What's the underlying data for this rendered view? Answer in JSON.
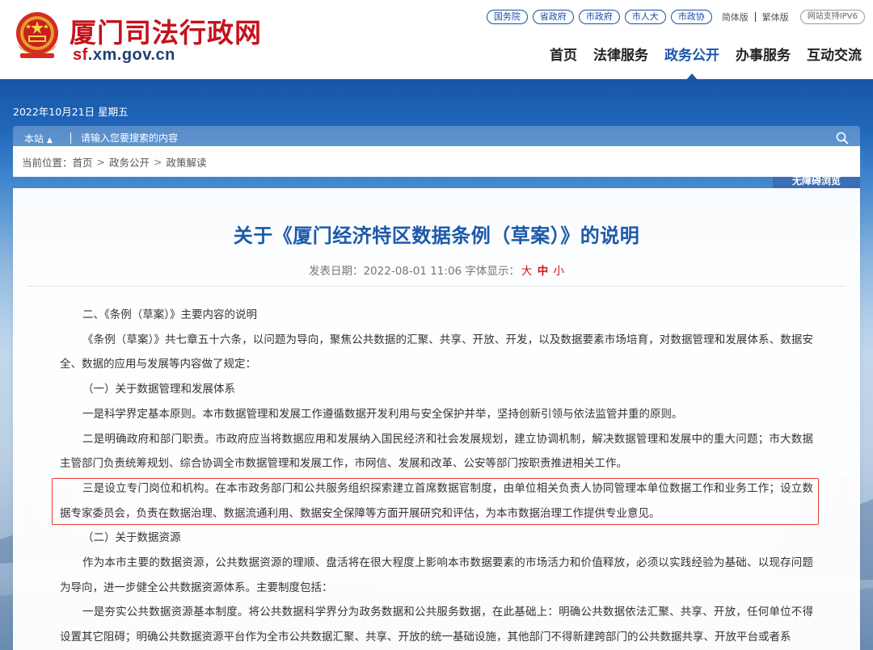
{
  "site": {
    "title": "厦门司法行政网",
    "domain_prefix": "sf",
    "domain_suffix": ".xm.gov.cn"
  },
  "top_links": {
    "pills": [
      "国务院",
      "省政府",
      "市政府",
      "市人大",
      "市政协"
    ],
    "simplified": "简体版",
    "traditional": "繁体版",
    "ipv6": "网站支持IPV6"
  },
  "nav": {
    "items": [
      "首页",
      "法律服务",
      "政务公开",
      "办事服务",
      "互动交流"
    ],
    "active": "政务公开"
  },
  "banner": {
    "date": "2022年10月21日 星期五"
  },
  "search": {
    "scope": "本站",
    "placeholder": "请输入您要搜索的内容",
    "access_label": "无障碍浏览"
  },
  "breadcrumb": {
    "prefix": "当前位置：",
    "items": [
      "首页",
      "政务公开",
      "政策解读"
    ],
    "separator": ">"
  },
  "article": {
    "title": "关于《厦门经济特区数据条例（草案）》的说明",
    "date_label": "发表日期：",
    "date": "2022-08-01 11:06",
    "font_label": "字体显示：",
    "font_big": "大",
    "font_mid": "中",
    "font_small": "小",
    "paragraphs": [
      "二、《条例（草案）》主要内容的说明",
      "《条例（草案）》共七章五十六条，以问题为导向，聚焦公共数据的汇聚、共享、开放、开发，以及数据要素市场培育，对数据管理和发展体系、数据安全、数据的应用与发展等内容做了规定：",
      "（一）关于数据管理和发展体系",
      "一是科学界定基本原则。本市数据管理和发展工作遵循数据开发利用与安全保护并举，坚持创新引领与依法监管并重的原则。",
      "二是明确政府和部门职责。市政府应当将数据应用和发展纳入国民经济和社会发展规划，建立协调机制，解决数据管理和发展中的重大问题；市大数据主管部门负责统筹规划、综合协调全市数据管理和发展工作，市网信、发展和改革、公安等部门按职责推进相关工作。",
      "三是设立专门岗位和机构。在本市政务部门和公共服务组织探索建立首席数据官制度，由单位相关负责人协同管理本单位数据工作和业务工作；设立数据专家委员会，负责在数据治理、数据流通利用、数据安全保障等方面开展研究和评估，为本市数据治理工作提供专业意见。",
      "（二）关于数据资源",
      "作为本市主要的数据资源，公共数据资源的理顺、盘活将在很大程度上影响本市数据要素的市场活力和价值释放，必须以实践经验为基础、以现存问题为导向，进一步健全公共数据资源体系。主要制度包括：",
      "一是夯实公共数据资源基本制度。将公共数据科学界分为政务数据和公共服务数据，在此基础上：明确公共数据依法汇聚、共享、开放，任何单位不得设置其它阻碍；明确公共数据资源平台作为全市公共数据汇聚、共享、开放的统一基础设施，其他部门不得新建跨部门的公共数据共享、开放平台或者系"
    ]
  }
}
